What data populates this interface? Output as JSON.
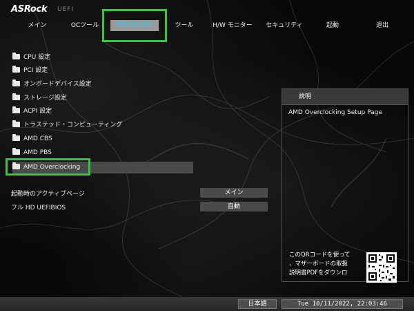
{
  "header": {
    "logo": "ASRock",
    "logo_sub": "UEFI",
    "tabs": [
      {
        "label": "メイン"
      },
      {
        "label": "OCツール"
      },
      {
        "label": "アドバンスド"
      },
      {
        "label": "ツール"
      },
      {
        "label": "H/W モニター"
      },
      {
        "label": "セキュリティ"
      },
      {
        "label": "起動"
      },
      {
        "label": "退出"
      }
    ],
    "active_tab": "アドバンスド",
    "highlight_color": "#3ec24a",
    "active_tab_text_color": "#2fc6ff"
  },
  "menu": {
    "items": [
      {
        "label": "CPU 設定"
      },
      {
        "label": "PCI 設定"
      },
      {
        "label": "オンボードデバイス設定"
      },
      {
        "label": "ストレージ設定"
      },
      {
        "label": "ACPI 設定"
      },
      {
        "label": "トラステッド・コンピューティング"
      },
      {
        "label": "AMD CBS"
      },
      {
        "label": "AMD PBS"
      },
      {
        "label": "AMD Overclocking"
      }
    ],
    "selected": "AMD Overclocking",
    "icon": "folder-icon"
  },
  "settings": [
    {
      "label": "起動時のアクティブページ",
      "value": "メイン"
    },
    {
      "label": "フル HD UEFIBIOS",
      "value": "自動"
    }
  ],
  "description": {
    "title": "説明",
    "text": "AMD Overclocking Setup Page",
    "qr_lines": [
      "このQRコードを使って",
      "、マザーボードの取扱",
      "説明書PDFをダウンロ"
    ]
  },
  "footer": {
    "language": "日本語",
    "datetime": "Tue 10/11/2022, 22:03:46"
  }
}
